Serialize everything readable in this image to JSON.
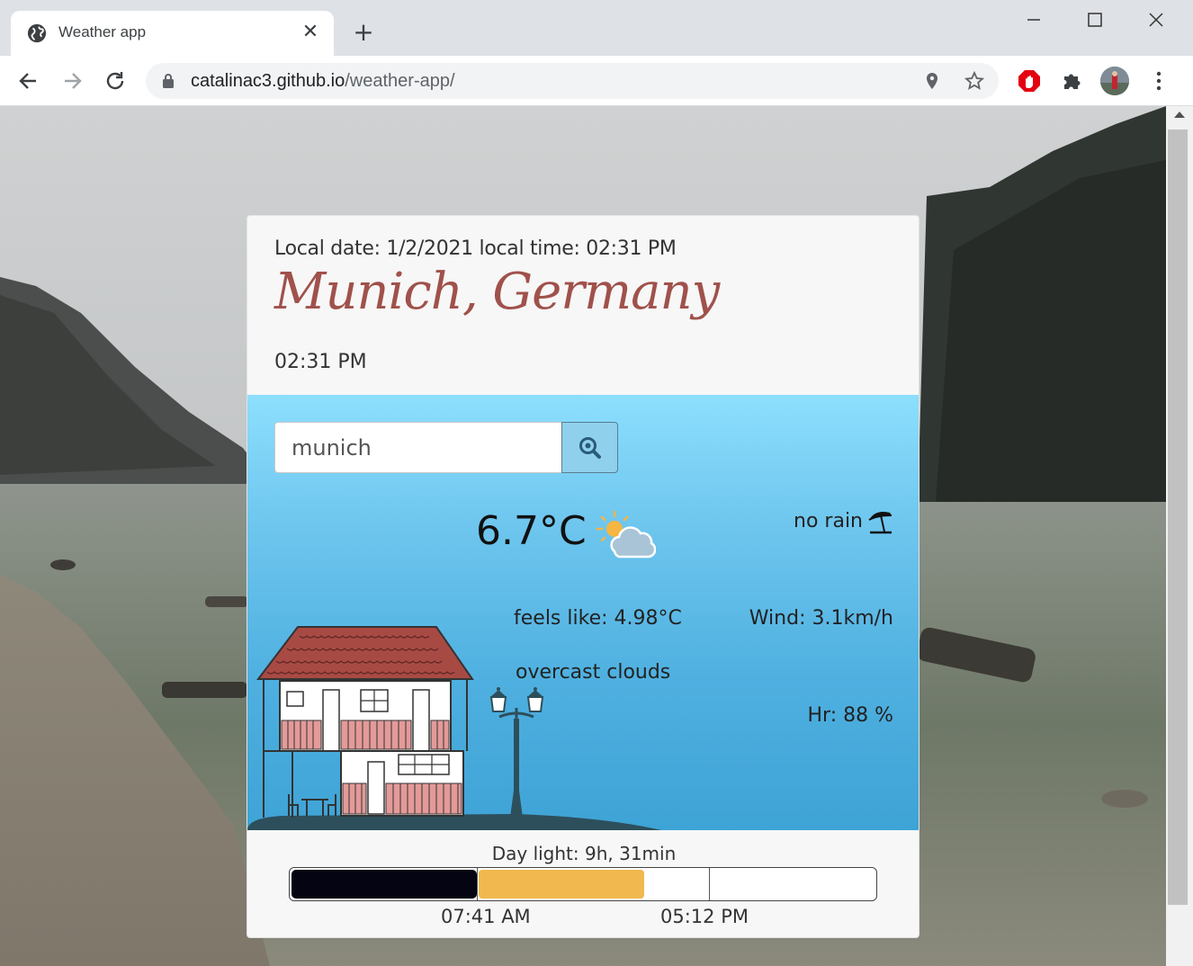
{
  "browser": {
    "tab_title": "Weather app",
    "url_host": "catalinac3.github.io",
    "url_path": "/weather-app/"
  },
  "card": {
    "local_datetime": "Local date: 1/2/2021 local time: 02:31 PM",
    "city": "Munich, Germany",
    "current_time": "02:31 PM"
  },
  "search": {
    "value": "munich"
  },
  "weather": {
    "temperature": "6.7°C",
    "rain": "no rain",
    "feels_like": "feels like: 4.98°C",
    "wind": "Wind: 3.1km/h",
    "description": "overcast clouds",
    "humidity": "Hr: 88 %",
    "icon": "partly-cloudy-icon"
  },
  "daylight": {
    "label": "Day light: 9h, 31min",
    "sunrise": "07:41 AM",
    "sunset": "05:12 PM",
    "progress_fraction": 0.28
  },
  "colors": {
    "city": "#a0514b",
    "night_bar": "#040412",
    "day_bar": "#f1b84f",
    "sky_top": "#8ddffd",
    "sky_bottom": "#3ea3d6"
  }
}
